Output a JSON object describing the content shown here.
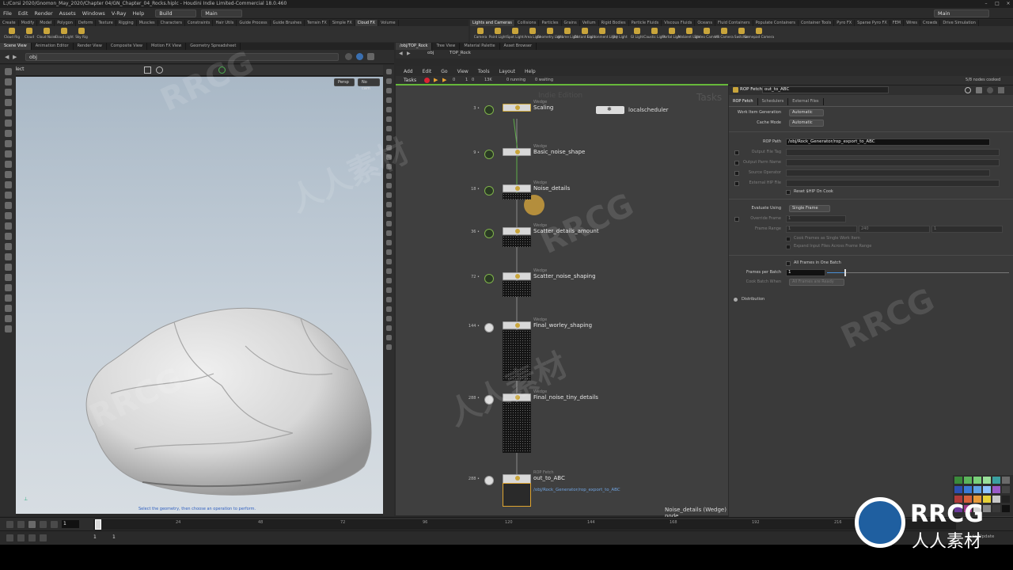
{
  "window": {
    "title": "L:/Corsi 2020/Gnomon_May_2020/Chapter 04/GN_Chapter_04_Rocks.hiplc - Houdini Indie Limited-Commercial 18.0.460",
    "right_desktop": "Main"
  },
  "menu": {
    "items": [
      "File",
      "Edit",
      "Render",
      "Assets",
      "Windows",
      "V-Ray",
      "Help"
    ],
    "build": "Build",
    "desktop": "Main"
  },
  "shelf_left": {
    "tabs": [
      "Create",
      "Modify",
      "Model",
      "Polygon",
      "Deform",
      "Texture",
      "Rigging",
      "Muscles",
      "Characters",
      "Constraints",
      "Hair Utils",
      "Guide Process",
      "Guide Brushes",
      "Terrain FX",
      "Simple FX",
      "Cloud FX",
      "Volume"
    ],
    "active_tab": "Cloud FX",
    "tools": [
      "Cloud Rig",
      "Cloud",
      "Cloud Noise",
      "Cloud Light",
      "Sky Rig"
    ]
  },
  "shelf_right": {
    "tabs": [
      "Lights and Cameras",
      "Collisions",
      "Particles",
      "Grains",
      "Vellum",
      "Rigid Bodies",
      "Particle Fluids",
      "Viscous Fluids",
      "Oceans",
      "Fluid Containers",
      "Populate Containers",
      "Container Tools",
      "Pyro FX",
      "Sparse Pyro FX",
      "FEM",
      "Wires",
      "Crowds",
      "Drive Simulation"
    ],
    "active_tab": "Lights and Cameras",
    "tools": [
      "Camera",
      "Point Light",
      "Spot Light",
      "Area Light",
      "Geometry Light",
      "Volume Light",
      "Distant Light",
      "Environment Light",
      "Sky Light",
      "GI Light",
      "Caustic Light",
      "Portal Light",
      "Ambient Light",
      "Stereo Camera",
      "VR Camera",
      "Switcher",
      "Gamepad Camera"
    ]
  },
  "left_pane": {
    "tabs": [
      "Scene View",
      "Animation Editor",
      "Render View",
      "Composite View",
      "Motion FX View",
      "Geometry Spreadsheet"
    ],
    "active_tab": "Scene View",
    "path": "obj",
    "tool_label": "Select",
    "view_menu": "Persp",
    "cam_menu": "No cam",
    "status_text": "Select the geometry, then choose an operation to perform."
  },
  "right_pane": {
    "tabs": [
      "/obj/TOP_Rock",
      "Tree View",
      "Material Palette",
      "Asset Browser"
    ],
    "active_tab": "/obj/TOP_Rock",
    "path_root": "obj",
    "path_node": "TOP_Rock",
    "menu": [
      "Add",
      "Edit",
      "Go",
      "View",
      "Tools",
      "Layout",
      "Help"
    ],
    "tasks_label": "Tasks",
    "task_stats": [
      "0",
      "1",
      "0",
      "13K",
      "0 running",
      "0 waiting"
    ],
    "nodes_cooked": "5/8 nodes cooked",
    "watermark_edition": "Indie Edition",
    "watermark_tasks": "Tasks",
    "footer_label": "Noise_details (Wedge) node"
  },
  "scheduler": {
    "name": "localscheduler"
  },
  "nodes": [
    {
      "type": "Wedge",
      "name": "Scaling",
      "count": "3",
      "status": "done",
      "grid_rows": 0
    },
    {
      "type": "Wedge",
      "name": "Basic_noise_shape",
      "count": "9",
      "status": "done",
      "grid_rows": 0
    },
    {
      "type": "Wedge",
      "name": "Noise_details",
      "count": "18",
      "status": "done",
      "grid_rows": 1
    },
    {
      "type": "Wedge",
      "name": "Scatter_details_amount",
      "count": "36",
      "status": "done",
      "grid_rows": 2
    },
    {
      "type": "Wedge",
      "name": "Scatter_noise_shaping",
      "count": "72",
      "status": "done",
      "grid_rows": 3
    },
    {
      "type": "Wedge",
      "name": "Final_worley_shaping",
      "count": "144",
      "status": "idle",
      "grid_rows": 6
    },
    {
      "type": "Wedge",
      "name": "Final_noise_tiny_details",
      "count": "288",
      "status": "idle",
      "grid_rows": 6
    },
    {
      "type": "ROP Fetch",
      "name": "out_to_ABC",
      "count": "288",
      "status": "idle",
      "grid_rows": 0,
      "path": "/obj/Rock_Generator/rop_export_to_ABC"
    }
  ],
  "params": {
    "node_type": "ROP Fetch",
    "node_name": "out_to_ABC",
    "tabs": [
      "ROP Fetch",
      "Schedulers",
      "External Files"
    ],
    "active_tab": "ROP Fetch",
    "work_item_generation": {
      "label": "Work Item Generation",
      "value": "Automatic"
    },
    "cache_mode": {
      "label": "Cache Mode",
      "value": "Automatic"
    },
    "rop_path": {
      "label": "ROP Path",
      "value": "/obj/Rock_Generator/rop_export_to_ABC"
    },
    "output_file_tag": "Output File Tag",
    "output_parm_name": "Output Parm Name",
    "source_operator": "Source Operator",
    "external_hip_file": "External HIP File",
    "reset_ship": "Reset $HIP On Cook",
    "evaluate_using": {
      "label": "Evaluate Using",
      "value": "Single Frame"
    },
    "override_frame": {
      "label": "Override Frame",
      "value": "1"
    },
    "frame_range": {
      "label": "Frame Range",
      "values": [
        "1",
        "240",
        "1"
      ]
    },
    "cook_frames": "Cook Frames as Single Work Item",
    "expand_input": "Expand Input Files Across Frame Range",
    "all_frames_batch": "All Frames in One Batch",
    "frames_per_batch": {
      "label": "Frames per Batch",
      "value": "1"
    },
    "cook_batch_when": {
      "label": "Cook Batch When",
      "value": "All Frames are Ready"
    },
    "distribution": "Distribution"
  },
  "timeline": {
    "frame": "1",
    "ticks": [
      "24",
      "48",
      "72",
      "96",
      "120",
      "144",
      "168",
      "192",
      "216"
    ],
    "start": "1",
    "end": "1",
    "auto_update": "Auto Update"
  },
  "watermarks": {
    "brand": "RRCG",
    "cn": "人人素材"
  },
  "colors": {
    "accent": "#c9a53b",
    "ok": "#7fb24a",
    "timeline_cur": "#4a8fd6"
  }
}
